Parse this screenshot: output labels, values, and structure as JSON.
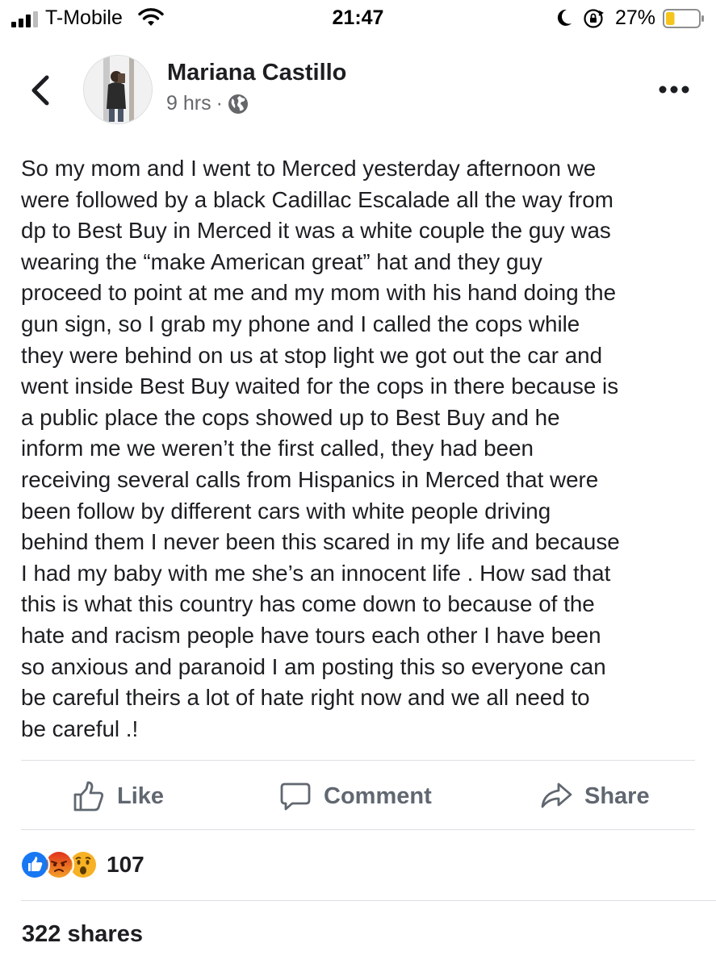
{
  "status_bar": {
    "carrier": "T-Mobile",
    "time": "21:47",
    "battery_percent": "27%",
    "battery_level": 0.27,
    "battery_color": "#f5c41d"
  },
  "post": {
    "author": "Mariana Castillo",
    "timestamp": "9 hrs",
    "separator": "·",
    "privacy_icon": "globe-icon",
    "text": "So my mom  and I went to Merced yesterday afternoon we\nwere followed  by a black Cadillac Escalade all the way from\ndp to Best Buy in Merced it was a white couple the guy was\nwearing the “make American great” hat and they guy\nproceed to point at me and my mom with his hand doing the\ngun sign, so I grab my phone and I called the cops while\nthey were behind on us at stop light we got out the car and\nwent inside Best Buy waited for the cops in there because is\na public place the cops  showed up to Best Buy and he\ninform me we weren’t the first called,  they had  been\nreceiving several calls   from Hispanics in Merced that were\nbeen follow by different cars with white people driving\nbehind them I never been this scared in my life and because\nI had my baby with me she’s an innocent life . How sad that\nthis is what this country has  come down to  because of the\nhate and racism people have tours each other I have been\nso anxious and paranoid I am posting this so everyone can\nbe careful theirs a lot of hate right now and we all need to\nbe careful .!"
  },
  "actions": {
    "like_label": "Like",
    "comment_label": "Comment",
    "share_label": "Share"
  },
  "engagement": {
    "reaction_icons": [
      "like-reaction-icon",
      "angry-reaction-icon",
      "wow-reaction-icon"
    ],
    "reaction_count": "107",
    "shares": "322 shares"
  },
  "colors": {
    "action_gray": "#606770",
    "like_blue": "#1877f2",
    "angry_orange": "#e9710f",
    "wow_yellow": "#f7b125"
  }
}
